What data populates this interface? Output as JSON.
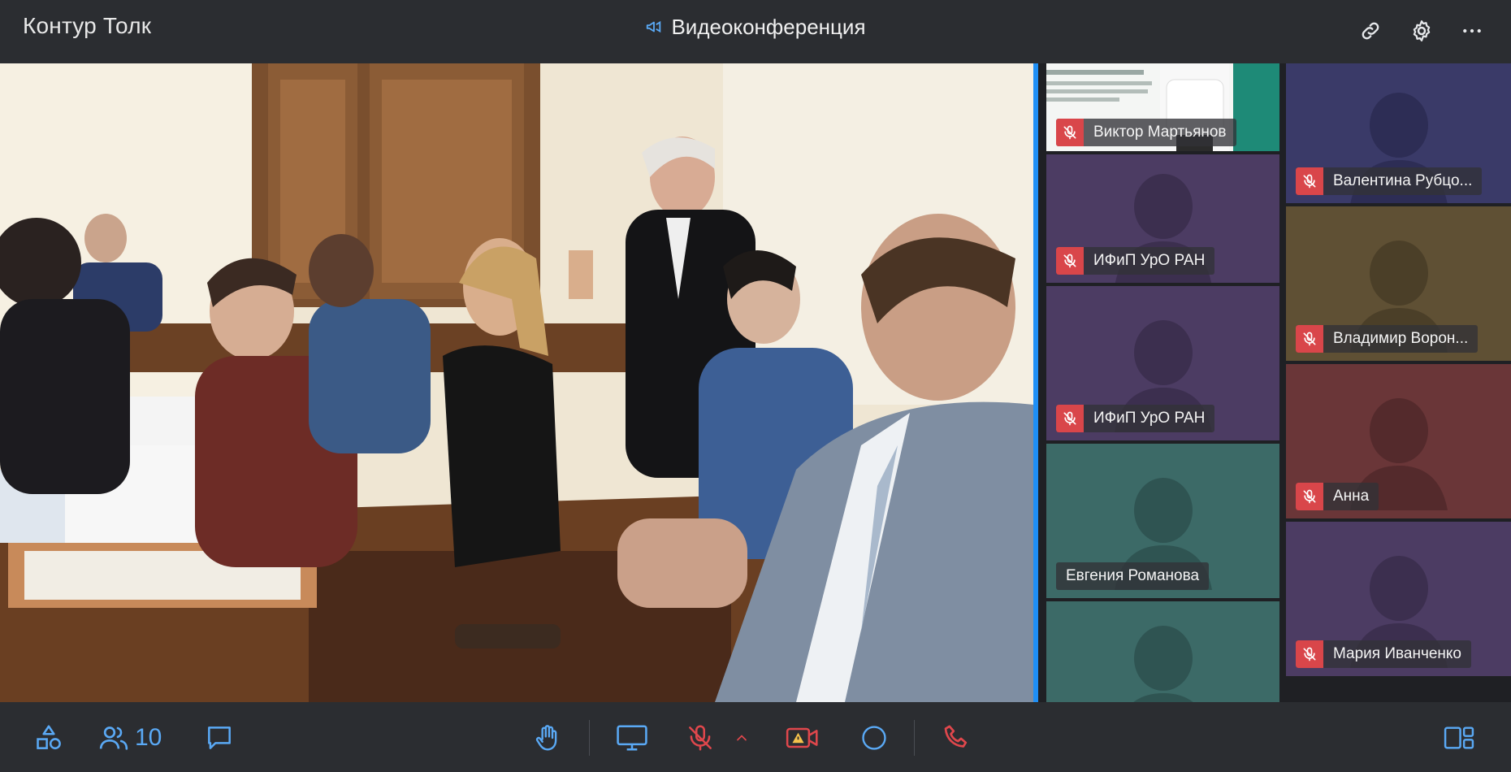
{
  "header": {
    "app_title": "Контур Толк",
    "conference_title": "Видеоконференция",
    "icons": [
      "megaphone-icon",
      "link-icon",
      "gear-icon",
      "more-icon"
    ]
  },
  "participants_tiles": [
    {
      "name": "Виктор Мартьянов",
      "muted": true,
      "bg": "#1e8a77"
    },
    {
      "name": "Валентина Рубцо...",
      "muted": true,
      "bg": "#3a3a68"
    },
    {
      "name": "ИФиП УрО РАН",
      "muted": true,
      "bg": "#4c3c63"
    },
    {
      "name": "Владимир Ворон...",
      "muted": true,
      "bg": "#5f5034"
    },
    {
      "name": "ИФиП УрО РАН",
      "muted": true,
      "bg": "#4c3c63"
    },
    {
      "name": "Анна",
      "muted": true,
      "bg": "#6a3638"
    },
    {
      "name": "Евгения Романова",
      "muted": false,
      "bg": "#3c6a67"
    },
    {
      "name": "Мария Иванченко",
      "muted": true,
      "bg": "#4c3c63"
    },
    {
      "name": "",
      "muted": false,
      "bg": "#3c6a67"
    }
  ],
  "toolbar": {
    "participants_count": "10",
    "icons": [
      "shapes-icon",
      "people-icon",
      "chat-icon",
      "raise-hand-icon",
      "screen-share-icon",
      "mic-off-icon",
      "chevron-up-icon",
      "camera-warning-icon",
      "record-icon",
      "hang-up-icon",
      "layout-icon"
    ]
  },
  "colors": {
    "accent": "#5aa9f5",
    "danger": "#e0474c",
    "active_speaker_border": "#1f8ff5",
    "warning": "#f5c24c"
  }
}
